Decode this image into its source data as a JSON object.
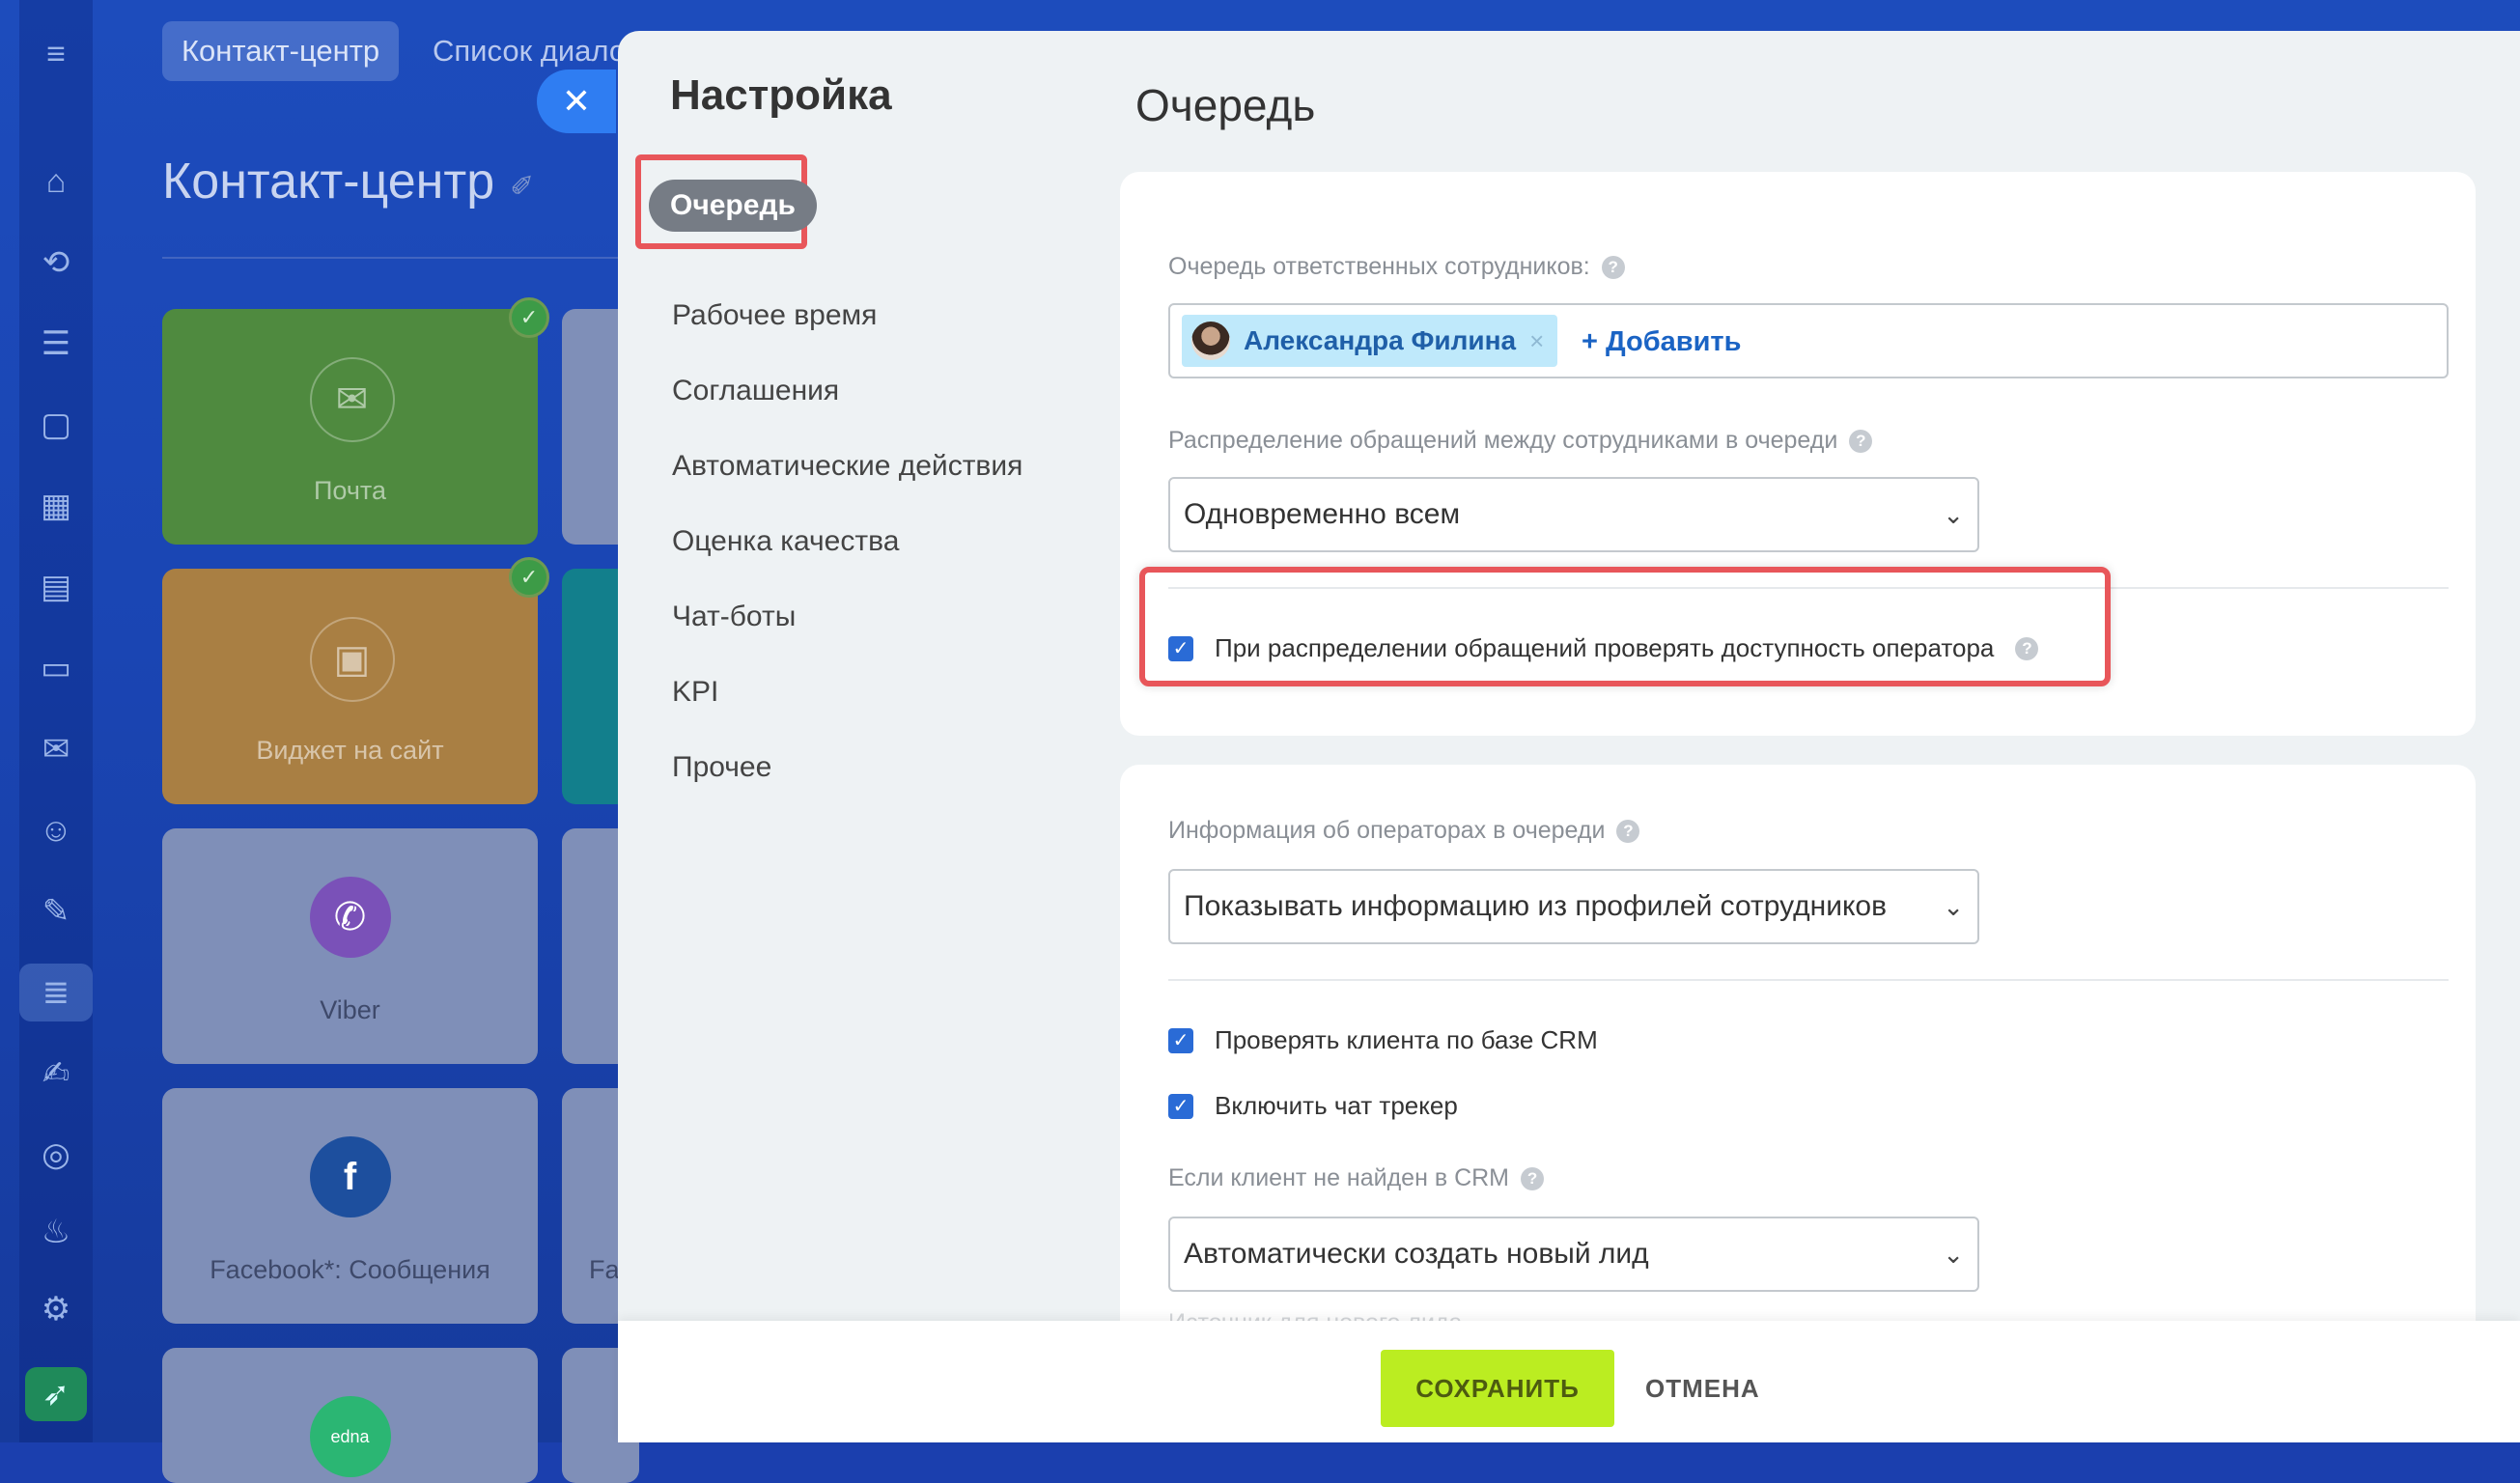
{
  "background": {
    "topbar_tabs": [
      "Контакт-центр",
      "Список диало"
    ],
    "page_title": "Контакт-центр",
    "tiles": [
      {
        "label": "Почта",
        "color": "#4f8a3f",
        "icon": "mail-icon",
        "connected": true
      },
      {
        "label": "Виджет на сайт",
        "color": "#a97f43",
        "icon": "chat-widget-icon",
        "connected": true
      },
      {
        "label": "Viber",
        "color": "#7f8fb8",
        "icon": "viber-icon",
        "connected": false
      },
      {
        "label": "Facebook*: Сообщения",
        "color": "#7f8fb8",
        "icon": "facebook-icon",
        "connected": false
      },
      {
        "label": "Fa",
        "color": "#7f8fb8",
        "icon": "",
        "connected": false
      },
      {
        "label": "",
        "color": "#7f8fb8",
        "icon": "edna-icon",
        "connected": false
      }
    ]
  },
  "settings": {
    "title": "Настройка",
    "menu": [
      "Очередь",
      "Рабочее время",
      "Соглашения",
      "Автоматические действия",
      "Оценка качества",
      "Чат-боты",
      "KPI",
      "Прочее"
    ],
    "active_menu_index": 0
  },
  "queue": {
    "title": "Очередь",
    "responsible_label": "Очередь ответственных сотрудников:",
    "employee_name": "Александра Филина",
    "add_label": "+ Добавить",
    "distribution_label": "Распределение обращений между сотрудниками в очереди",
    "distribution_value": "Одновременно всем",
    "check_availability_label": "При распределении обращений проверять доступность оператора",
    "operator_info_label": "Информация об операторах в очереди",
    "operator_info_value": "Показывать информацию из профилей сотрудников",
    "check_crm_label": "Проверять клиента по базе CRM",
    "chat_tracker_label": "Включить чат трекер",
    "not_found_label": "Если клиент не найден в CRM",
    "not_found_value": "Автоматически создать новый лид",
    "lead_source_label": "Источник для нового лида"
  },
  "footer": {
    "save": "СОХРАНИТЬ",
    "cancel": "ОТМЕНА"
  },
  "colors": {
    "accent": "#2a6bd6",
    "save": "#bbed21",
    "highlight": "#e8565a"
  }
}
